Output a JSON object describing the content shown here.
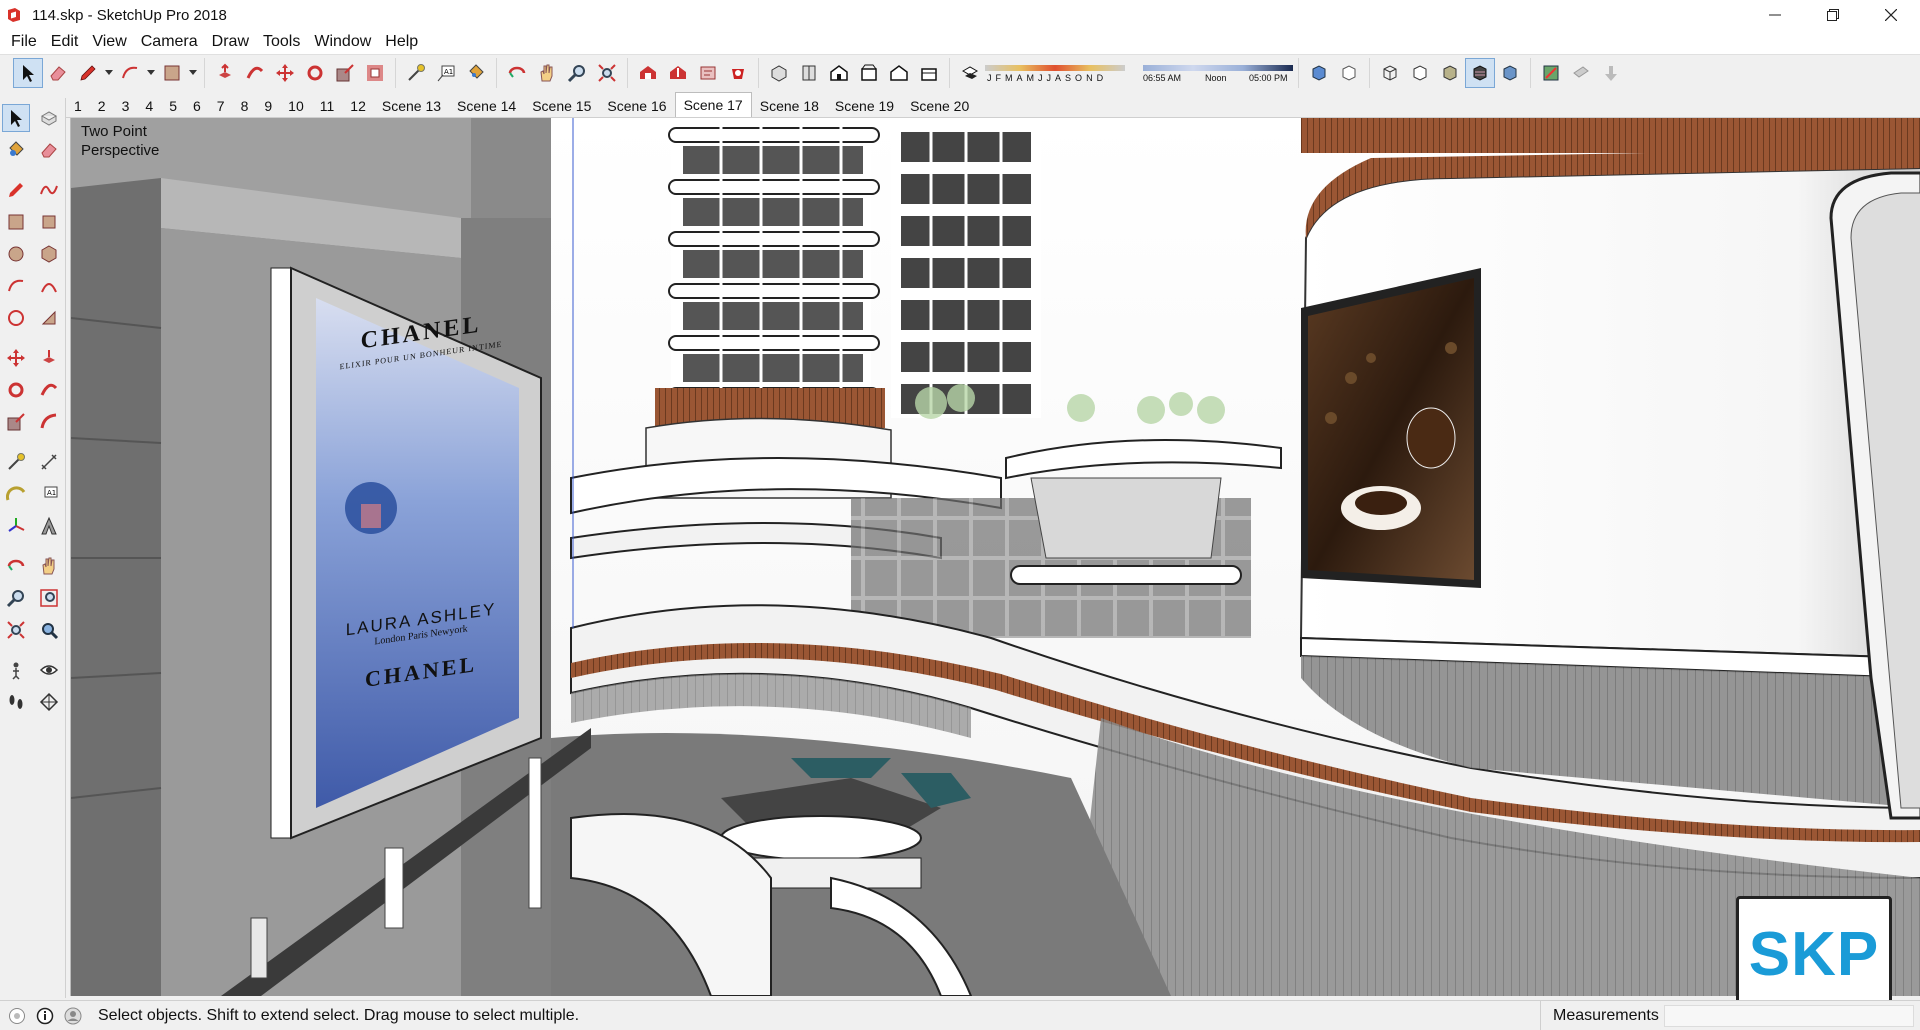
{
  "window": {
    "title": "114.skp - SketchUp Pro 2018",
    "controls": [
      "minimize-icon",
      "restore-icon",
      "close-icon"
    ]
  },
  "menu": [
    "File",
    "Edit",
    "View",
    "Camera",
    "Draw",
    "Tools",
    "Window",
    "Help"
  ],
  "shadows": {
    "months": [
      "J",
      "F",
      "M",
      "A",
      "M",
      "J",
      "J",
      "A",
      "S",
      "O",
      "N",
      "D"
    ],
    "time_start": "06:55 AM",
    "time_mid": "Noon",
    "time_end": "05:00 PM"
  },
  "scenes": [
    "1",
    "2",
    "3",
    "4",
    "5",
    "6",
    "7",
    "8",
    "9",
    "10",
    "11",
    "12",
    "Scene 13",
    "Scene 14",
    "Scene 15",
    "Scene 16",
    "Scene 17",
    "Scene 18",
    "Scene 19",
    "Scene 20"
  ],
  "active_scene": "Scene 17",
  "viewport": {
    "label_line1": "Two Point",
    "label_line2": "Perspective",
    "ad_left": {
      "brand_top": "CHANEL",
      "tagline": "ELIXIR POUR UN BONHEUR INTIME",
      "mid_text": "LAURA ASHLEY",
      "mid_sub": "London Paris Newyork",
      "brand_bottom": "CHANEL"
    },
    "badge": "SKP"
  },
  "status": {
    "hint": "Select objects. Shift to extend select. Drag mouse to select multiple.",
    "measurements_label": "Measurements",
    "measurements_value": ""
  },
  "colors": {
    "accent_selected": "#cfe1f3",
    "badge_blue": "#1a9bd7",
    "wood": "#8a4a2a"
  }
}
